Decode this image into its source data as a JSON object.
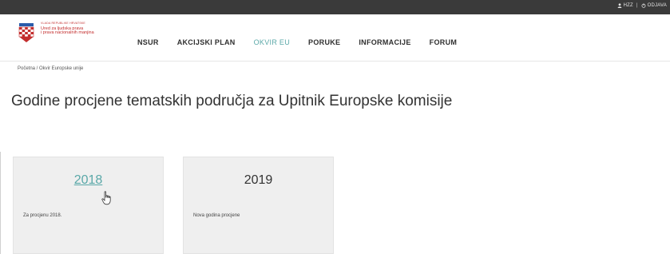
{
  "topbar": {
    "user_label": "HZZ",
    "logout_label": "ODJAVA"
  },
  "logo": {
    "line0": "VLADA REPUBLIKE HRVATSKE",
    "line1": "Ured za ljudska prava",
    "line2": "i prava nacionalnih manjina"
  },
  "nav": [
    {
      "label": "NSUR",
      "active": false
    },
    {
      "label": "AKCIJSKI PLAN",
      "active": false
    },
    {
      "label": "OKVIR EU",
      "active": true
    },
    {
      "label": "PORUKE",
      "active": false
    },
    {
      "label": "INFORMACIJE",
      "active": false
    },
    {
      "label": "FORUM",
      "active": false
    }
  ],
  "breadcrumb": "Početna / Okvir Europske unije",
  "page_title": "Godine procjene tematskih područja za Upitnik Europske komisije",
  "cards": [
    {
      "year": "2018",
      "description": "Za procjenu 2018."
    },
    {
      "year": "2019",
      "description": "Nova godina procjene"
    }
  ],
  "colors": {
    "accent": "#5aa8a8",
    "topbar": "#3a3a3a",
    "brand_red": "#c32e2e",
    "card_bg": "#efefef"
  }
}
